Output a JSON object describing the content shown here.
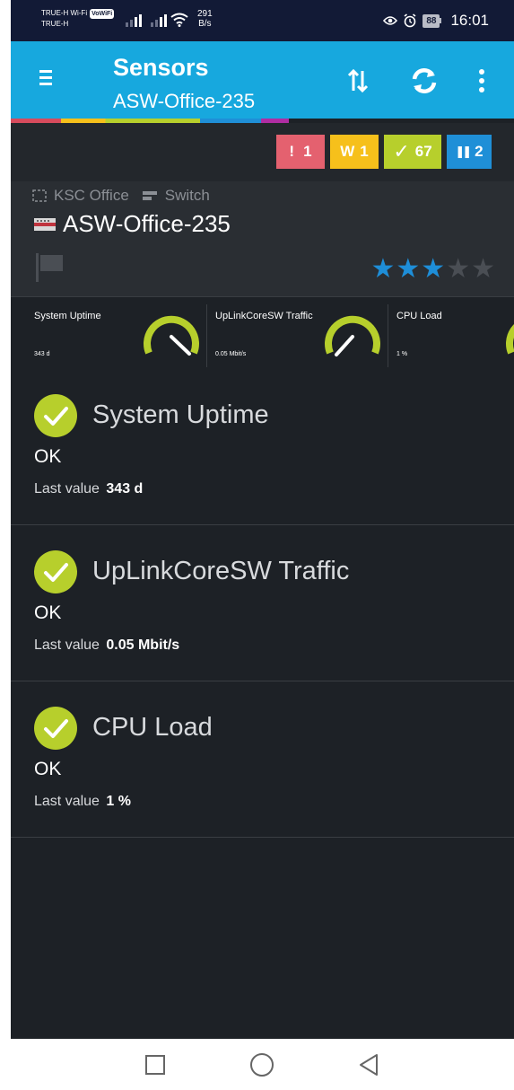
{
  "status_bar": {
    "carrier_line1": "TRUE-H Wi-Fi",
    "volte_label": "VoWiFi",
    "carrier_line2": "TRUE-H",
    "net_speed_value": "291",
    "net_speed_unit": "B/s",
    "battery": "88",
    "time": "16:01"
  },
  "app_bar": {
    "title": "Sensors",
    "subtitle": "ASW-Office-235",
    "background_color": "#17a8de",
    "icons": [
      "menu-icon",
      "sort-icon",
      "refresh-icon",
      "more-vert-icon"
    ]
  },
  "summary_badges": [
    {
      "symbol": "!",
      "count": "1",
      "color": "#e4616f"
    },
    {
      "symbol": "W",
      "count": "1",
      "color": "#f6c01b"
    },
    {
      "symbol": "✓",
      "count": "67",
      "color": "#b7cf2c"
    },
    {
      "symbol": "❚❚",
      "count": "2",
      "color": "#1f8fd7"
    }
  ],
  "device": {
    "group": "KSC Office",
    "type": "Switch",
    "name": "ASW-Office-235",
    "stars_filled": 3,
    "stars_total": 5
  },
  "gauges": [
    {
      "name": "System Uptime",
      "value": "343 d"
    },
    {
      "name": "UpLinkCoreSW Traffic",
      "value": "0.05 Mbit/s"
    },
    {
      "name": "CPU Load",
      "value": "1 %"
    }
  ],
  "sensors": [
    {
      "name": "System Uptime",
      "status": "OK",
      "last_label": "Last value",
      "last_value": "343 d"
    },
    {
      "name": "UpLinkCoreSW Traffic",
      "status": "OK",
      "last_label": "Last value",
      "last_value": "0.05 Mbit/s"
    },
    {
      "name": "CPU Load",
      "status": "OK",
      "last_label": "Last value",
      "last_value": "1 %"
    }
  ],
  "colors": {
    "ok_green": "#b7cf2c",
    "star_blue": "#1e8ed8",
    "background": "#1d2126"
  }
}
